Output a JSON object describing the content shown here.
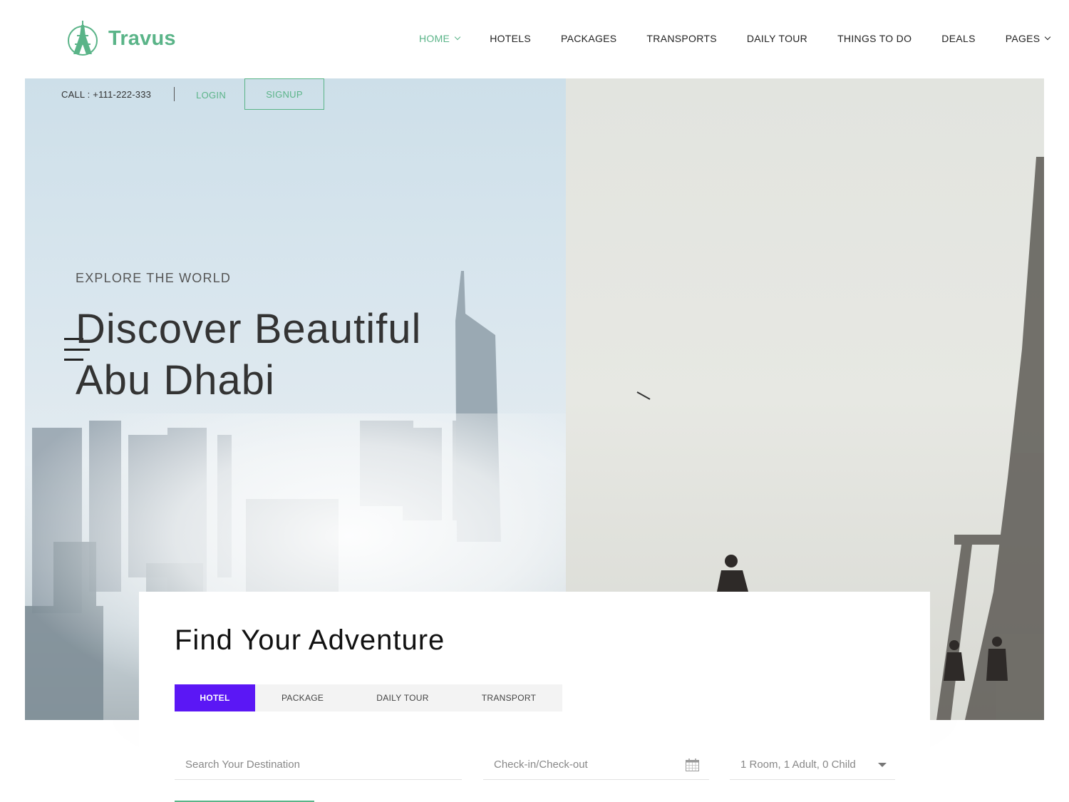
{
  "brand": {
    "name": "Travus",
    "color": "#5ab488"
  },
  "nav": {
    "items": [
      {
        "label": "HOME",
        "active": true,
        "dropdown": true
      },
      {
        "label": "HOTELS"
      },
      {
        "label": "PACKAGES"
      },
      {
        "label": "TRANSPORTS"
      },
      {
        "label": "DAILY TOUR"
      },
      {
        "label": "THINGS TO DO"
      },
      {
        "label": "DEALS"
      },
      {
        "label": "PAGES",
        "dropdown": true
      }
    ]
  },
  "topbar": {
    "call": "CALL : +111-222-333",
    "login": "LOGIN",
    "signup": "SIGNUP"
  },
  "hero": {
    "kicker": "EXPLORE THE WORLD",
    "headline_line1": "Discover Beautiful",
    "headline_line2": "Abu Dhabi"
  },
  "booking": {
    "title": "Find Your Adventure",
    "tabs": [
      {
        "label": "HOTEL",
        "active": true
      },
      {
        "label": "PACKAGE"
      },
      {
        "label": "DAILY TOUR"
      },
      {
        "label": "TRANSPORT"
      }
    ],
    "destination_placeholder": "Search Your Destination",
    "dates_placeholder": "Check-in/Check-out",
    "guests_value": "1 Room, 1 Adult, 0 Child",
    "accent": "#5b17f5"
  },
  "icons": {
    "logo": "eiffel-tower-logo-icon",
    "menu": "menu-lines-icon",
    "calendar": "calendar-icon",
    "caret": "caret-down-icon",
    "chevron": "chevron-down-icon"
  }
}
